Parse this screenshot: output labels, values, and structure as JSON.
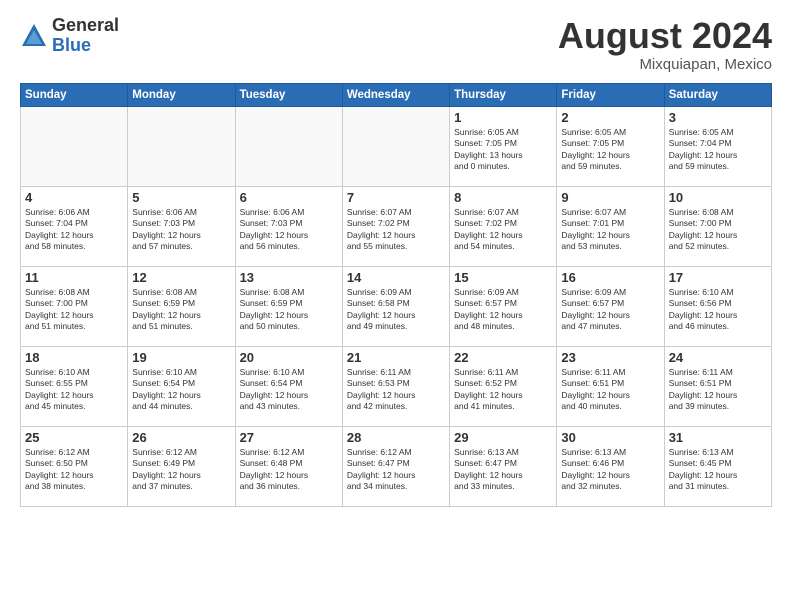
{
  "header": {
    "logo_general": "General",
    "logo_blue": "Blue",
    "month_year": "August 2024",
    "location": "Mixquiapan, Mexico"
  },
  "weekdays": [
    "Sunday",
    "Monday",
    "Tuesday",
    "Wednesday",
    "Thursday",
    "Friday",
    "Saturday"
  ],
  "weeks": [
    [
      {
        "day": "",
        "info": ""
      },
      {
        "day": "",
        "info": ""
      },
      {
        "day": "",
        "info": ""
      },
      {
        "day": "",
        "info": ""
      },
      {
        "day": "1",
        "info": "Sunrise: 6:05 AM\nSunset: 7:05 PM\nDaylight: 13 hours\nand 0 minutes."
      },
      {
        "day": "2",
        "info": "Sunrise: 6:05 AM\nSunset: 7:05 PM\nDaylight: 12 hours\nand 59 minutes."
      },
      {
        "day": "3",
        "info": "Sunrise: 6:05 AM\nSunset: 7:04 PM\nDaylight: 12 hours\nand 59 minutes."
      }
    ],
    [
      {
        "day": "4",
        "info": "Sunrise: 6:06 AM\nSunset: 7:04 PM\nDaylight: 12 hours\nand 58 minutes."
      },
      {
        "day": "5",
        "info": "Sunrise: 6:06 AM\nSunset: 7:03 PM\nDaylight: 12 hours\nand 57 minutes."
      },
      {
        "day": "6",
        "info": "Sunrise: 6:06 AM\nSunset: 7:03 PM\nDaylight: 12 hours\nand 56 minutes."
      },
      {
        "day": "7",
        "info": "Sunrise: 6:07 AM\nSunset: 7:02 PM\nDaylight: 12 hours\nand 55 minutes."
      },
      {
        "day": "8",
        "info": "Sunrise: 6:07 AM\nSunset: 7:02 PM\nDaylight: 12 hours\nand 54 minutes."
      },
      {
        "day": "9",
        "info": "Sunrise: 6:07 AM\nSunset: 7:01 PM\nDaylight: 12 hours\nand 53 minutes."
      },
      {
        "day": "10",
        "info": "Sunrise: 6:08 AM\nSunset: 7:00 PM\nDaylight: 12 hours\nand 52 minutes."
      }
    ],
    [
      {
        "day": "11",
        "info": "Sunrise: 6:08 AM\nSunset: 7:00 PM\nDaylight: 12 hours\nand 51 minutes."
      },
      {
        "day": "12",
        "info": "Sunrise: 6:08 AM\nSunset: 6:59 PM\nDaylight: 12 hours\nand 51 minutes."
      },
      {
        "day": "13",
        "info": "Sunrise: 6:08 AM\nSunset: 6:59 PM\nDaylight: 12 hours\nand 50 minutes."
      },
      {
        "day": "14",
        "info": "Sunrise: 6:09 AM\nSunset: 6:58 PM\nDaylight: 12 hours\nand 49 minutes."
      },
      {
        "day": "15",
        "info": "Sunrise: 6:09 AM\nSunset: 6:57 PM\nDaylight: 12 hours\nand 48 minutes."
      },
      {
        "day": "16",
        "info": "Sunrise: 6:09 AM\nSunset: 6:57 PM\nDaylight: 12 hours\nand 47 minutes."
      },
      {
        "day": "17",
        "info": "Sunrise: 6:10 AM\nSunset: 6:56 PM\nDaylight: 12 hours\nand 46 minutes."
      }
    ],
    [
      {
        "day": "18",
        "info": "Sunrise: 6:10 AM\nSunset: 6:55 PM\nDaylight: 12 hours\nand 45 minutes."
      },
      {
        "day": "19",
        "info": "Sunrise: 6:10 AM\nSunset: 6:54 PM\nDaylight: 12 hours\nand 44 minutes."
      },
      {
        "day": "20",
        "info": "Sunrise: 6:10 AM\nSunset: 6:54 PM\nDaylight: 12 hours\nand 43 minutes."
      },
      {
        "day": "21",
        "info": "Sunrise: 6:11 AM\nSunset: 6:53 PM\nDaylight: 12 hours\nand 42 minutes."
      },
      {
        "day": "22",
        "info": "Sunrise: 6:11 AM\nSunset: 6:52 PM\nDaylight: 12 hours\nand 41 minutes."
      },
      {
        "day": "23",
        "info": "Sunrise: 6:11 AM\nSunset: 6:51 PM\nDaylight: 12 hours\nand 40 minutes."
      },
      {
        "day": "24",
        "info": "Sunrise: 6:11 AM\nSunset: 6:51 PM\nDaylight: 12 hours\nand 39 minutes."
      }
    ],
    [
      {
        "day": "25",
        "info": "Sunrise: 6:12 AM\nSunset: 6:50 PM\nDaylight: 12 hours\nand 38 minutes."
      },
      {
        "day": "26",
        "info": "Sunrise: 6:12 AM\nSunset: 6:49 PM\nDaylight: 12 hours\nand 37 minutes."
      },
      {
        "day": "27",
        "info": "Sunrise: 6:12 AM\nSunset: 6:48 PM\nDaylight: 12 hours\nand 36 minutes."
      },
      {
        "day": "28",
        "info": "Sunrise: 6:12 AM\nSunset: 6:47 PM\nDaylight: 12 hours\nand 34 minutes."
      },
      {
        "day": "29",
        "info": "Sunrise: 6:13 AM\nSunset: 6:47 PM\nDaylight: 12 hours\nand 33 minutes."
      },
      {
        "day": "30",
        "info": "Sunrise: 6:13 AM\nSunset: 6:46 PM\nDaylight: 12 hours\nand 32 minutes."
      },
      {
        "day": "31",
        "info": "Sunrise: 6:13 AM\nSunset: 6:45 PM\nDaylight: 12 hours\nand 31 minutes."
      }
    ]
  ]
}
